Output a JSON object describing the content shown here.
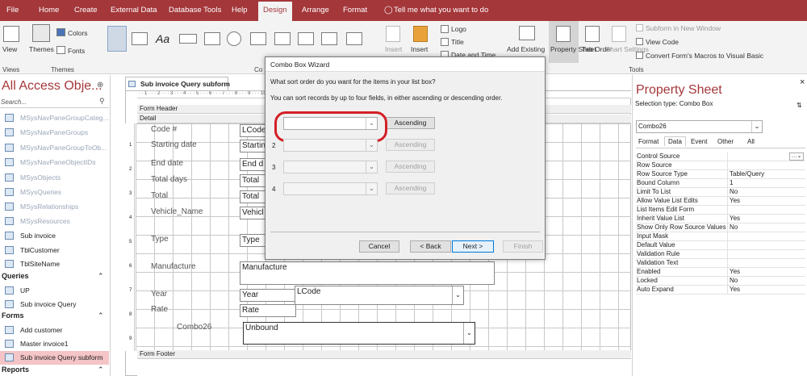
{
  "menu_tabs": [
    "File",
    "Home",
    "Create",
    "External Data",
    "Database Tools",
    "Help",
    "Design",
    "Arrange",
    "Format"
  ],
  "active_tab": "Design",
  "tell_me": "Tell me what you want to do",
  "ribbon": {
    "view": "View",
    "themes": "Themes",
    "colors": "Colors",
    "fonts": "Fonts",
    "insert1": "Insert",
    "insert2": "Insert",
    "logo": "Logo",
    "title": "Title",
    "date_time": "Date and Time",
    "add_existing": "Add Existing",
    "property_sheet": "Property Sheet",
    "tab_order": "Tab Order",
    "chart_settings": "Chart Settings",
    "subform_new_window": "Subform in New Window",
    "view_code": "View Code",
    "convert_macros": "Convert Form's Macros to Visual Basic",
    "group_views": "Views",
    "group_themes": "Themes",
    "group_controls": "Co",
    "group_tools": "Tools"
  },
  "nav": {
    "title": "All Access Obje...",
    "search_placeholder": "Search...",
    "tables": [
      "MSysNavPaneGroupCateg...",
      "MSysNavPaneGroups",
      "MSysNavPaneGroupToOb...",
      "MSysNavPaneObjectIDs",
      "MSysObjects",
      "MSysQueries",
      "MSysRelationships",
      "MSysResources",
      "Sub invoice",
      "TblCustomer",
      "TblSiteName"
    ],
    "queries_header": "Queries",
    "queries": [
      "UP",
      "Sub invoice Query"
    ],
    "forms_header": "Forms",
    "forms": [
      "Add customer",
      "Master invoice1",
      "Sub invoice Query subform"
    ],
    "reports_header": "Reports"
  },
  "designer": {
    "tab_title": "Sub invoice Query subform",
    "form_header": "Form Header",
    "detail": "Detail",
    "form_footer": "Form Footer",
    "ruler_numbers": [
      "1",
      "2",
      "3",
      "4",
      "5",
      "6",
      "7",
      "8",
      "9"
    ],
    "fields": [
      {
        "label": "Code #",
        "value": "LCode"
      },
      {
        "label": "Starting date",
        "value": "Startin"
      },
      {
        "label": "End date",
        "value": "End d"
      },
      {
        "label": "Total days",
        "value": "Total"
      },
      {
        "label": "Total",
        "value": "Total"
      },
      {
        "label": "Vehicle_Name",
        "value": "Vehicl"
      },
      {
        "label": "Type",
        "value": "Type"
      },
      {
        "label": "Manufacture",
        "value": "Manufacture"
      },
      {
        "label": "Year",
        "value": "Year"
      },
      {
        "label": "Rate",
        "value": "Rate"
      }
    ],
    "year_combo": "LCode",
    "combo26_label": "Combo26",
    "combo26_value": "Unbound"
  },
  "dialog": {
    "title": "Combo Box Wizard",
    "question": "What sort order do you want for the items in your list box?",
    "hint": "You can sort records by up to four fields, in either ascending or descending order.",
    "rows": [
      {
        "num": "1",
        "button": "Ascending"
      },
      {
        "num": "2",
        "button": "Ascending"
      },
      {
        "num": "3",
        "button": "Ascending"
      },
      {
        "num": "4",
        "button": "Ascending"
      }
    ],
    "cancel": "Cancel",
    "back": "< Back",
    "next": "Next >",
    "finish": "Finish"
  },
  "props": {
    "title": "Property Sheet",
    "selection_type": "Selection type:  Combo Box",
    "selected_object": "Combo26",
    "tabs": [
      "Format",
      "Data",
      "Event",
      "Other",
      "All"
    ],
    "active_tab": "Data",
    "rows": [
      {
        "name": "Control Source",
        "value": ""
      },
      {
        "name": "Row Source",
        "value": ""
      },
      {
        "name": "Row Source Type",
        "value": "Table/Query"
      },
      {
        "name": "Bound Column",
        "value": "1"
      },
      {
        "name": "Limit To List",
        "value": "No"
      },
      {
        "name": "Allow Value List Edits",
        "value": "Yes"
      },
      {
        "name": "List Items Edit Form",
        "value": ""
      },
      {
        "name": "Inherit Value List",
        "value": "Yes"
      },
      {
        "name": "Show Only Row Source Values",
        "value": "No"
      },
      {
        "name": "Input Mask",
        "value": ""
      },
      {
        "name": "Default Value",
        "value": ""
      },
      {
        "name": "Validation Rule",
        "value": ""
      },
      {
        "name": "Validation Text",
        "value": ""
      },
      {
        "name": "Enabled",
        "value": "Yes"
      },
      {
        "name": "Locked",
        "value": "No"
      },
      {
        "name": "Auto Expand",
        "value": "Yes"
      }
    ]
  },
  "colors": {
    "access_red": "#a4373a",
    "annotation": "#d32026"
  }
}
